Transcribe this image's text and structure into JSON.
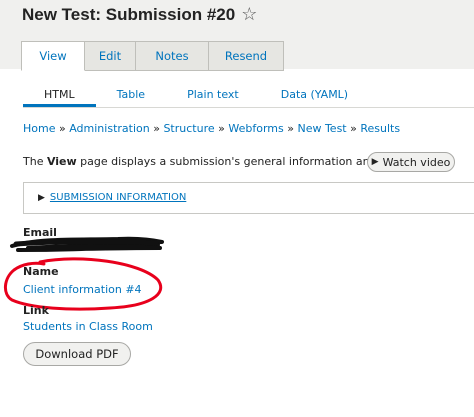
{
  "page": {
    "title": "New Test: Submission #20",
    "star_icon": "star-outline-icon"
  },
  "tabs": [
    {
      "label": "View",
      "active": true
    },
    {
      "label": "Edit",
      "active": false
    },
    {
      "label": "Notes",
      "active": false
    },
    {
      "label": "Resend",
      "active": false
    }
  ],
  "subtabs": [
    {
      "label": "HTML",
      "active": true
    },
    {
      "label": "Table",
      "active": false
    },
    {
      "label": "Plain text",
      "active": false
    },
    {
      "label": "Data (YAML)",
      "active": false
    }
  ],
  "breadcrumb": {
    "items": [
      "Home",
      "Administration",
      "Structure",
      "Webforms",
      "New Test",
      "Results"
    ],
    "separator": "»"
  },
  "description": {
    "prefix": "The ",
    "bold": "View",
    "suffix": " page displays a submission's general information and data."
  },
  "video_button": {
    "label": "Watch video",
    "icon": "play-icon"
  },
  "submission_info": {
    "label": "SUBMISSION INFORMATION",
    "icon": "triangle-right-icon"
  },
  "fields": {
    "email": {
      "label": "Email",
      "value_redacted": true
    },
    "name": {
      "label": "Name",
      "value": "Client information #4"
    },
    "link": {
      "label": "Link",
      "value": "Students in Class Room"
    }
  },
  "download_button": {
    "label": "Download PDF"
  },
  "colors": {
    "link": "#0074bd",
    "header_bg": "#f0f0ee",
    "annotation_red": "#e8001c",
    "scribble": "#111111"
  }
}
